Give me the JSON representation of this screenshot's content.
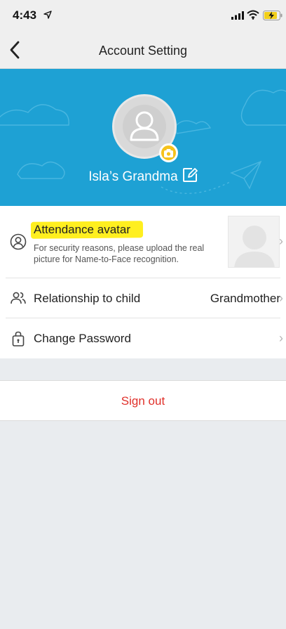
{
  "status_bar": {
    "time": "4:43",
    "icons": [
      "location-arrow-icon",
      "cellular-signal-icon",
      "wifi-icon",
      "battery-charging-icon"
    ]
  },
  "nav": {
    "title": "Account Setting",
    "back_icon": "chevron-left-icon"
  },
  "profile": {
    "name": "Isla’s Grandma",
    "avatar_icon": "user-placeholder-icon",
    "camera_icon": "camera-icon",
    "edit_icon": "edit-icon"
  },
  "settings": {
    "attendance": {
      "title": "Attendance avatar",
      "description": "For security reasons, please upload the real picture for Name-to-Face recognition.",
      "icon": "user-circle-icon",
      "highlight_color": "#ffef1f"
    },
    "relationship": {
      "title": "Relationship to child",
      "value": "Grandmother",
      "icon": "people-icon"
    },
    "password": {
      "title": "Change Password",
      "icon": "lock-icon"
    }
  },
  "sign_out": {
    "label": "Sign out",
    "color": "#e0302a"
  },
  "colors": {
    "header_bg": "#1ea1d4",
    "camera_badge": "#f6c21c",
    "page_bg": "#e9ecef"
  }
}
